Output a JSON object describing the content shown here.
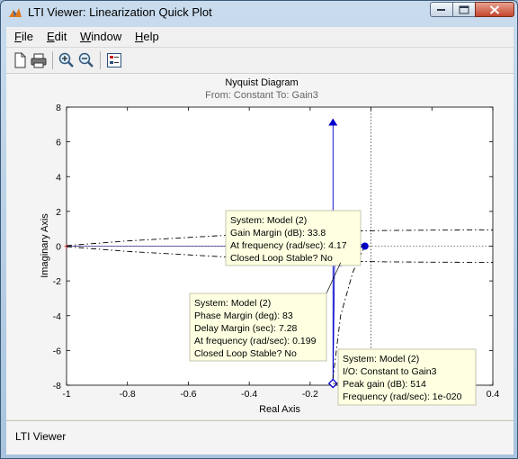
{
  "window": {
    "title": "LTI Viewer: Linearization Quick Plot"
  },
  "menu": [
    {
      "label": "File",
      "key": "F",
      "rest": "ile"
    },
    {
      "label": "Edit",
      "key": "E",
      "rest": "dit"
    },
    {
      "label": "Window",
      "key": "W",
      "rest": "indow"
    },
    {
      "label": "Help",
      "key": "H",
      "rest": "elp"
    }
  ],
  "toolbar": {
    "icons": [
      "new-document-icon",
      "print-icon",
      "zoom-in-icon",
      "zoom-out-icon",
      "plot-configurations-icon"
    ]
  },
  "plot": {
    "title": "Nyquist Diagram",
    "subtitle": "From: Constant  To: Gain3",
    "xlabel": "Real Axis",
    "ylabel": "Imaginary Axis",
    "xticks": [
      "-1",
      "-0.8",
      "-0.6",
      "-0.4",
      "-0.2",
      "0",
      "0.2",
      "0.4"
    ],
    "yticks": [
      "8",
      "6",
      "4",
      "2",
      "0",
      "-2",
      "-4",
      "-6",
      "-8"
    ]
  },
  "chart_data": {
    "type": "line",
    "title": "Nyquist Diagram",
    "subtitle": "From: Constant  To: Gain3",
    "xlabel": "Real Axis",
    "ylabel": "Imaginary Axis",
    "xlim": [
      -1,
      0.4
    ],
    "ylim": [
      -8,
      8
    ],
    "grid": false,
    "critical_point": {
      "x": -1,
      "y": 0
    },
    "series": [
      {
        "style": "solid",
        "points": [
          [
            -0.125,
            -8
          ],
          [
            -0.125,
            7.3
          ]
        ],
        "arrow_up_at": [
          -0.125,
          7.3
        ]
      },
      {
        "style": "solid",
        "points": [
          [
            -0.125,
            -8
          ],
          [
            -0.12,
            -1.2
          ],
          [
            -0.1,
            -0.4
          ],
          [
            -0.03,
            -0.05
          ],
          [
            -0.02,
            0.02
          ],
          [
            -0.05,
            0.2
          ],
          [
            -0.08,
            0.12
          ]
        ]
      },
      {
        "style": "dashdot",
        "points": [
          [
            -1,
            0.03
          ],
          [
            -0.8,
            0.3
          ],
          [
            -0.5,
            0.6
          ],
          [
            -0.3,
            0.76
          ],
          [
            -0.1,
            0.86
          ],
          [
            0.05,
            0.9
          ],
          [
            0.2,
            0.92
          ],
          [
            0.4,
            0.93
          ]
        ]
      },
      {
        "style": "dashdot",
        "points": [
          [
            -1,
            -0.03
          ],
          [
            -0.8,
            -0.3
          ],
          [
            -0.5,
            -0.6
          ],
          [
            -0.3,
            -0.76
          ],
          [
            -0.1,
            -0.86
          ],
          [
            0.05,
            -0.9
          ],
          [
            0.2,
            -0.92
          ],
          [
            0.4,
            -0.93
          ]
        ]
      },
      {
        "style": "dashdot",
        "points": [
          [
            -0.02,
            0.02
          ],
          [
            -0.06,
            -1.5
          ],
          [
            -0.1,
            -4
          ],
          [
            -0.125,
            -7.6
          ]
        ]
      }
    ],
    "markers": [
      {
        "x": -0.02,
        "y": 0.0,
        "shape": "dot",
        "label": "gain-margin"
      },
      {
        "x": -0.1,
        "y": -0.95,
        "shape": "dot",
        "label": "phase-margin"
      },
      {
        "x": -0.125,
        "y": -7.9,
        "shape": "diamond",
        "label": "peak-response"
      }
    ],
    "annotations": [
      {
        "lines": [
          "System: Model (2)",
          "Gain Margin (dB): 33.8",
          "At frequency (rad/sec): 4.17",
          "Closed Loop Stable? No"
        ]
      },
      {
        "lines": [
          "System: Model (2)",
          "Phase Margin (deg): 83",
          "Delay Margin (sec): 7.28",
          "At frequency (rad/sec): 0.199",
          "Closed Loop Stable? No"
        ]
      },
      {
        "lines": [
          "System: Model (2)",
          "I/O: Constant to Gain3",
          "Peak gain (dB): 514",
          "Frequency (rad/sec): 1e-020"
        ]
      }
    ]
  },
  "status": {
    "text": "LTI Viewer"
  }
}
